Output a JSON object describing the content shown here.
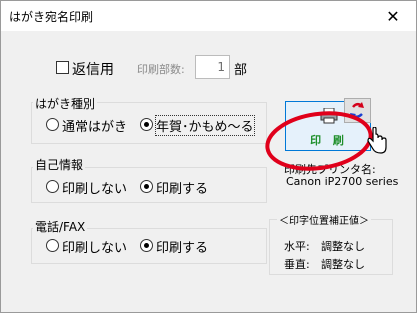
{
  "window": {
    "title": "はがき宛名印刷",
    "close_glyph": "✕"
  },
  "return_mail": {
    "label": "返信用",
    "checked": false
  },
  "print_copies": {
    "label": "印刷部数:",
    "value": "1",
    "unit": "部"
  },
  "postcard_type": {
    "title": "はがき種別",
    "options": [
      {
        "label": "通常はがき",
        "selected": false
      },
      {
        "label": "年賀･かもめ～る",
        "selected": true
      }
    ]
  },
  "self_info": {
    "title": "自己情報",
    "options": [
      {
        "label": "印刷しない",
        "selected": false
      },
      {
        "label": "印刷する",
        "selected": true
      }
    ]
  },
  "phone_fax": {
    "title": "電話/FAX",
    "options": [
      {
        "label": "印刷しない",
        "selected": false
      },
      {
        "label": "印刷する",
        "selected": true
      }
    ]
  },
  "print_button": {
    "label": "印 刷"
  },
  "printer": {
    "label": "印刷先プリンタ名:",
    "name": "Canon iP2700 series"
  },
  "position_correction": {
    "title": "＜印字位置補正値＞",
    "horizontal": {
      "label": "水平:",
      "value": "調整なし"
    },
    "vertical": {
      "label": "垂直:",
      "value": "調整なし"
    }
  },
  "colors": {
    "annotation_ring": "#e0001b",
    "print_label": "#1e8f2a",
    "button_highlight": "#0078d7"
  }
}
